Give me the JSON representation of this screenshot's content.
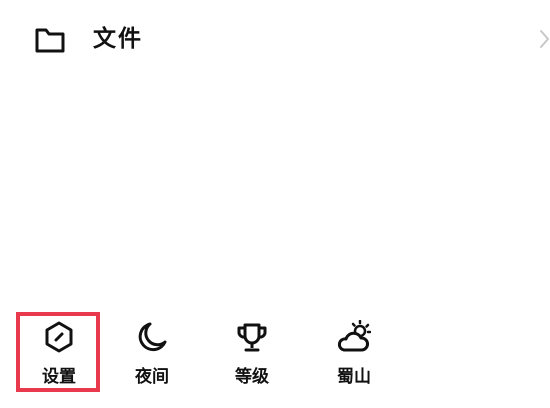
{
  "file_row": {
    "icon": "folder-icon",
    "label": "文件",
    "chevron": "chevron-right-icon"
  },
  "bottom_bar": {
    "items": [
      {
        "icon": "hexagon-settings-icon",
        "label": "设置"
      },
      {
        "icon": "moon-icon",
        "label": "夜间"
      },
      {
        "icon": "trophy-icon",
        "label": "等级"
      },
      {
        "icon": "weather-cloud-sun-icon",
        "label": "蜀山"
      }
    ]
  },
  "colors": {
    "highlight": "#e8394d",
    "text": "#111111",
    "chevron": "#c8c8c8"
  }
}
